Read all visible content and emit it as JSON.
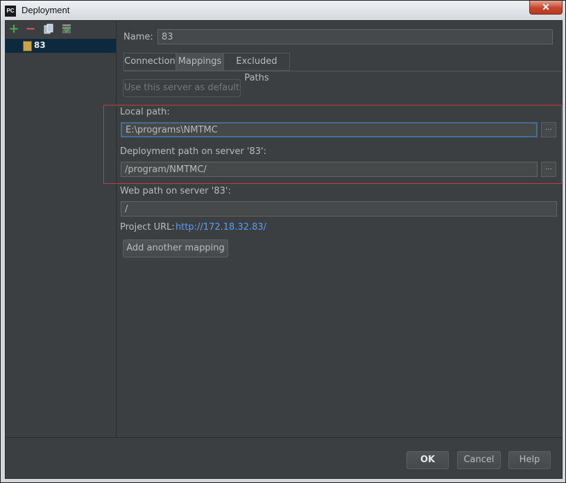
{
  "window": {
    "title": "Deployment",
    "logo": "PC",
    "close": "✕"
  },
  "toolbar": {
    "add_icon": "+",
    "remove_icon": "−",
    "copy_icon": "copy-icon",
    "deploy_icon": "deploy-icon"
  },
  "tree": {
    "items": [
      {
        "label": "83"
      }
    ]
  },
  "name": {
    "label": "Name:",
    "value": "83"
  },
  "tabs": [
    {
      "label": "Connection"
    },
    {
      "label": "Mappings"
    },
    {
      "label": "Excluded Paths"
    }
  ],
  "default_button": "Use this server as default",
  "local_path": {
    "label": "Local path:",
    "value": "E:\\programs\\NMTMC"
  },
  "deploy_path": {
    "label": "Deployment path on server '83':",
    "value": "/program/NMTMC/"
  },
  "web_path": {
    "label": "Web path on server '83':",
    "value": "/"
  },
  "project_url": {
    "label": "Project URL:",
    "value": "http://172.18.32.83/"
  },
  "add_mapping": "Add another mapping",
  "browse": "...",
  "buttons": {
    "ok": "OK",
    "cancel": "Cancel",
    "help": "Help"
  }
}
